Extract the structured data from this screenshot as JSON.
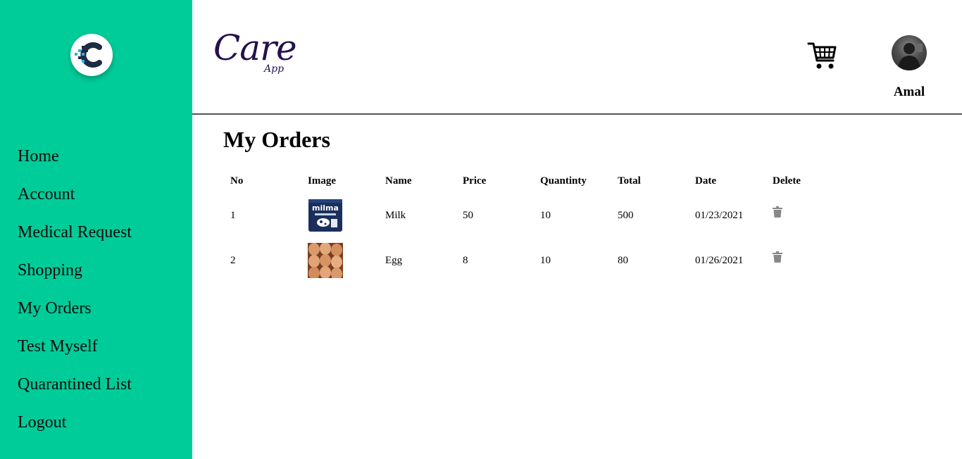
{
  "app": {
    "brand_main": "Care",
    "brand_sub": "App"
  },
  "sidebar": {
    "items": [
      {
        "label": "Home"
      },
      {
        "label": "Account"
      },
      {
        "label": "Medical Request"
      },
      {
        "label": "Shopping"
      },
      {
        "label": "My Orders"
      },
      {
        "label": "Test Myself"
      },
      {
        "label": "Quarantined List"
      },
      {
        "label": "Logout"
      }
    ]
  },
  "header": {
    "username": "Amal",
    "cart_icon": "shopping-cart-icon"
  },
  "main": {
    "title": "My Orders",
    "columns": [
      "No",
      "Image",
      "Name",
      "Price",
      "Quantinty",
      "Total",
      "Date",
      "Delete"
    ],
    "rows": [
      {
        "no": "1",
        "image": "milk-packet",
        "name": "Milk",
        "price": "50",
        "quantity": "10",
        "total": "500",
        "date": "01/23/2021"
      },
      {
        "no": "2",
        "image": "eggs",
        "name": "Egg",
        "price": "8",
        "quantity": "10",
        "total": "80",
        "date": "01/26/2021"
      }
    ]
  },
  "colors": {
    "sidebar_bg": "#00cc99",
    "brand": "#25104f",
    "delete_icon": "#888888"
  }
}
